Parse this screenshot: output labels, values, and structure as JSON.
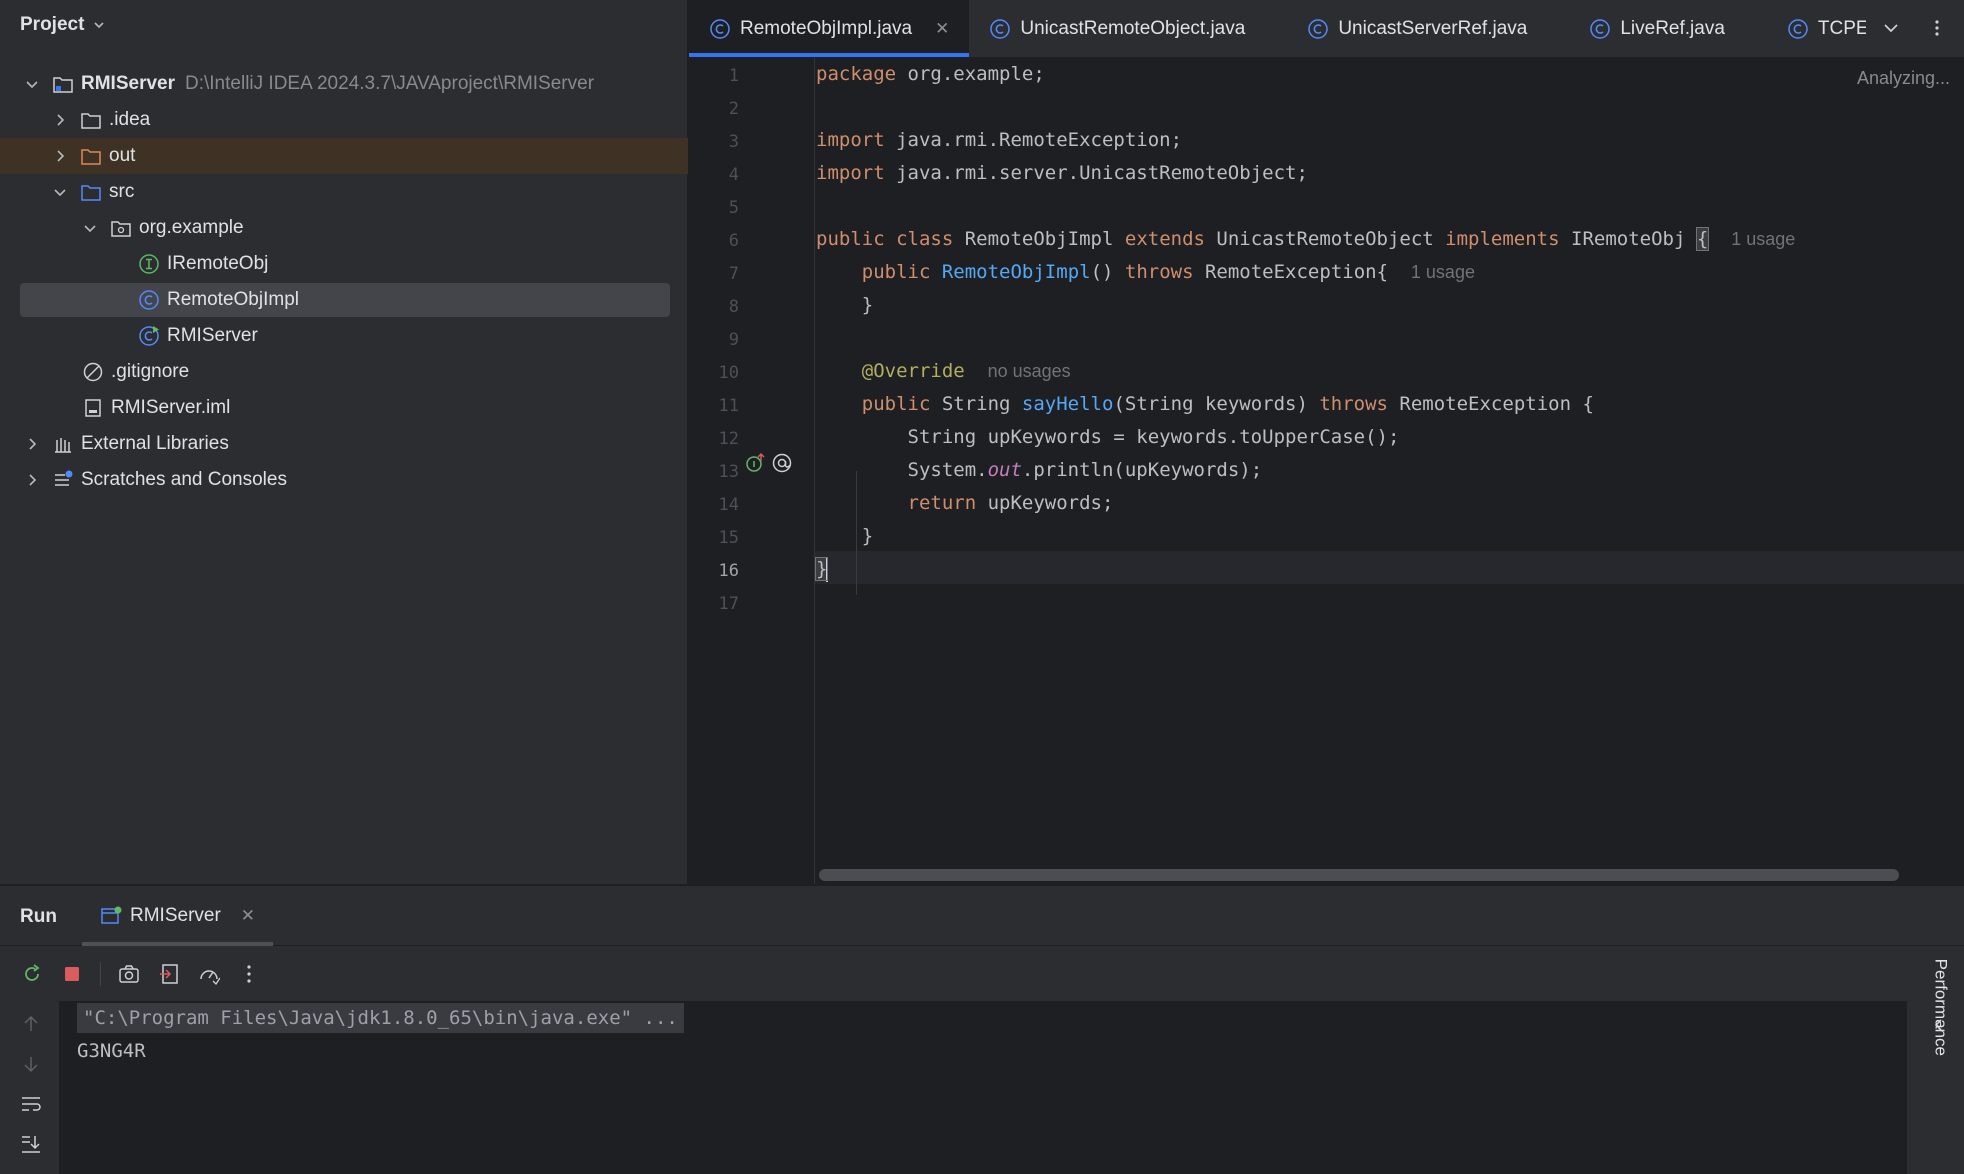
{
  "project_panel": {
    "title": "Project",
    "tree": [
      {
        "label": "RMIServer",
        "path": "D:\\IntelliJ IDEA 2024.3.7\\JAVAproject\\RMIServer"
      },
      {
        "label": ".idea"
      },
      {
        "label": "out"
      },
      {
        "label": "src"
      },
      {
        "label": "org.example"
      },
      {
        "label": "IRemoteObj"
      },
      {
        "label": "RemoteObjImpl"
      },
      {
        "label": "RMIServer"
      },
      {
        "label": ".gitignore"
      },
      {
        "label": "RMIServer.iml"
      },
      {
        "label": "External Libraries"
      },
      {
        "label": "Scratches and Consoles"
      }
    ]
  },
  "editor": {
    "tabs": [
      {
        "label": "RemoteObjImpl.java",
        "active": true
      },
      {
        "label": "UnicastRemoteObject.java"
      },
      {
        "label": "UnicastServerRef.java"
      },
      {
        "label": "LiveRef.java"
      },
      {
        "label": "TCPEn"
      }
    ],
    "status": "Analyzing...",
    "current_line": 16,
    "line_numbers": [
      "1",
      "2",
      "3",
      "4",
      "5",
      "6",
      "7",
      "8",
      "9",
      "10",
      "11",
      "12",
      "13",
      "14",
      "15",
      "16",
      "17"
    ],
    "code": {
      "l1_kw": "package",
      "l1_rest": " org.example;",
      "l3_kw": "import",
      "l3_rest": " java.rmi.RemoteException;",
      "l4_kw": "import",
      "l4_rest": " java.rmi.server.UnicastRemoteObject;",
      "l6_a": "public class",
      "l6_b": " RemoteObjImpl ",
      "l6_c": "extends",
      "l6_d": " UnicastRemoteObject ",
      "l6_e": "implements",
      "l6_f": " IRemoteObj ",
      "l6_brace": "{",
      "l6_hint": "1 usage",
      "l7_a": "public",
      "l7_fn": "RemoteObjImpl",
      "l7_b": "() ",
      "l7_c": "throws",
      "l7_d": " RemoteException{",
      "l7_hint": "1 usage",
      "l8": "}",
      "l10_ann": "@Override",
      "l10_hint": "no usages",
      "l11_a": "public",
      "l11_b": " String ",
      "l11_fn": "sayHello",
      "l11_c": "(String keywords) ",
      "l11_d": "throws",
      "l11_e": " RemoteException {",
      "l12": "String upKeywords = keywords.toUpperCase();",
      "l13_a": "System.",
      "l13_st": "out",
      "l13_b": ".println(upKeywords);",
      "l14_kw": "return",
      "l14_rest": " upKeywords;",
      "l15": "}",
      "l16": "}"
    }
  },
  "run_panel": {
    "title": "Run",
    "tab_label": "RMIServer",
    "console": {
      "cmd": "\"C:\\Program Files\\Java\\jdk1.8.0_65\\bin\\java.exe\" ...",
      "output": "G3NG4R"
    },
    "side_label": "Performance"
  },
  "colors": {
    "accent": "#3574f0",
    "keyword": "#cf8e6d",
    "function": "#56a8f5",
    "annotation": "#b3ae60",
    "static_field": "#c77dbb",
    "stop_red": "#db5c5c",
    "run_green": "#5fb865"
  }
}
